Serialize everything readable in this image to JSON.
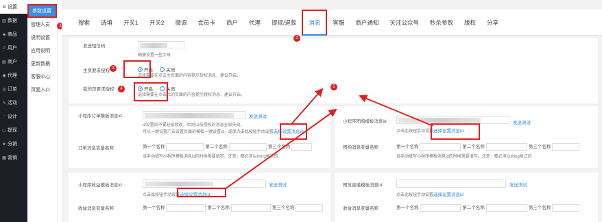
{
  "sidebar": {
    "items": [
      {
        "label": "设置",
        "icon": "gear-icon",
        "glyph": "⚙"
      },
      {
        "label": "数据",
        "icon": "chart-icon",
        "glyph": "▥"
      },
      {
        "label": "商品",
        "icon": "goods-icon",
        "glyph": "◈"
      },
      {
        "label": "用户",
        "icon": "user-icon",
        "glyph": "☺"
      },
      {
        "label": "商户",
        "icon": "shop-icon",
        "glyph": "▤"
      },
      {
        "label": "代理",
        "icon": "agent-icon",
        "glyph": "◉"
      },
      {
        "label": "订单",
        "icon": "order-icon",
        "glyph": "◎"
      },
      {
        "label": "活动",
        "icon": "activity-icon",
        "glyph": "✎"
      },
      {
        "label": "设计",
        "icon": "design-icon",
        "glyph": "◌"
      },
      {
        "label": "提现",
        "icon": "withdraw-icon",
        "glyph": "▭"
      },
      {
        "label": "分销",
        "icon": "distribution-icon",
        "glyph": "★"
      },
      {
        "label": "营销",
        "icon": "marketing-icon",
        "glyph": "▦"
      }
    ]
  },
  "subnav": {
    "items": [
      "参数设置",
      "管理人员",
      "说明设置",
      "应用说明",
      "更新数据",
      "客服中心",
      "页面入口"
    ]
  },
  "tabs": [
    "搜索",
    "选填",
    "开关1",
    "开关2",
    "微调",
    "会员卡",
    "商户",
    "代理",
    "提现/退款",
    "消息",
    "客服",
    "商户通知",
    "关注公众号",
    "秒杀参数",
    "版权",
    "分享"
  ],
  "form": {
    "sender_label": "发送短信码",
    "sender_hint": "随便设置一些字母",
    "home_auth_label": "主页要求授权",
    "my_auth_label": "我的页要求授权",
    "on": "开启",
    "off": "关闭",
    "home_auth_hint": "选择需要在点击主页面的内容提示授权消息，建议开启。",
    "my_auth_hint": "选择需要在点击我的页面的内容提示授权消息，建议开启。"
  },
  "cards": {
    "order_tpl_label": "小程序订单模板消息id",
    "order_tpl_hint1": "id设置后不要轻易修改，否则以前授权的消息全部失效。",
    "order_tpl_hint2": "可以一键设置广告设置页面的模板一键设置id，或单点击此按钮手动设置",
    "send_test": "发送测试",
    "manual_link": "选择设置消息id",
    "manual_prefix": "点击此按钮手动设置",
    "order_var_label": "订单消息变量名称",
    "first_name": "第一个名称",
    "second_name": "第二个名称",
    "third_name": "第三个名称",
    "var_hint": "当手动填写小程序模板消息id的时候需要填写。注意：都必须以thing格式的",
    "group_tpl_label": "小程序团购模板消息id",
    "group_var_label": "团购消息变量名称",
    "income_tpl_label": "小程序收益模板消息id",
    "income_var_label": "收益消息变量名称",
    "live_tpl_label": "预览直播模板消息id",
    "live_var_label": "收益消息变量名称"
  },
  "badges": [
    "1",
    "2",
    "3",
    "4",
    "5"
  ],
  "colors": {
    "accent": "#2f8ae5",
    "annotation": "#e02020",
    "sidebar": "#1c1f26"
  }
}
